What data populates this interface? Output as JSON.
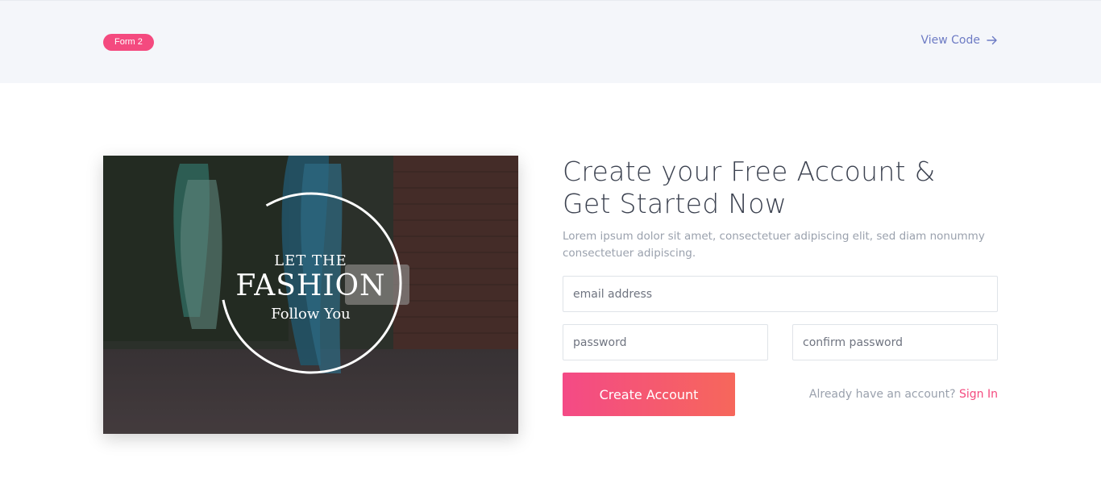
{
  "header": {
    "badge": "Form 2",
    "view_code": "View Code"
  },
  "hero": {
    "line1": "LET THE",
    "line2": "FASHION",
    "line3": "Follow You"
  },
  "form": {
    "title_line1": "Create your Free Account &",
    "title_line2": "Get Started Now",
    "subtitle_line1": "Lorem ipsum dolor sit amet, consectetuer adipiscing elit, sed diam nonummy",
    "subtitle_line2": "consectetuer adipiscing.",
    "email_placeholder": "email address",
    "password_placeholder": "password",
    "confirm_placeholder": "confirm password",
    "submit_label": "Create Account",
    "signin_prompt": "Already have an account?",
    "signin_link": "Sign In"
  },
  "colors": {
    "accent": "#f44a7f",
    "gradient_start": "#f44a86",
    "gradient_end": "#f6675b",
    "link": "#6d7bc4"
  }
}
